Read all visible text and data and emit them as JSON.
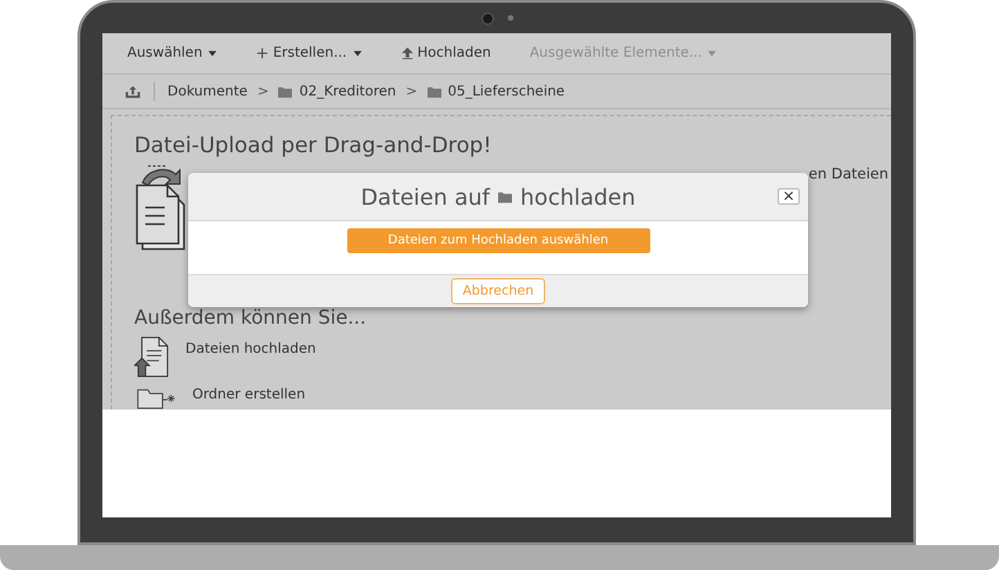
{
  "toolbar": {
    "items": [
      {
        "label": "Auswählen",
        "kind": "plain",
        "dropdown": true,
        "disabled": false
      },
      {
        "label": "Erstellen...",
        "kind": "plus",
        "dropdown": true,
        "disabled": false
      },
      {
        "label": "Hochladen",
        "kind": "upload",
        "dropdown": false,
        "disabled": false
      },
      {
        "label": "Ausgewählte Elemente...",
        "kind": "plain",
        "dropdown": true,
        "disabled": true
      }
    ]
  },
  "breadcrumb": {
    "separator": ">",
    "items": [
      {
        "label": "Dokumente",
        "folder": false
      },
      {
        "label": "02_Kreditoren",
        "folder": true
      },
      {
        "label": "05_Lieferscheine",
        "folder": true
      }
    ]
  },
  "content": {
    "heading": "Datei-Upload per Drag-and-Drop!",
    "side_text": "en Dateien",
    "section_heading": "Außerdem können Sie...",
    "actions": [
      {
        "label": "Dateien hochladen",
        "kind": "upload"
      },
      {
        "label": "Ordner erstellen",
        "kind": "folder"
      }
    ]
  },
  "dialog": {
    "title_before": "Dateien auf",
    "title_after": "hochladen",
    "close": "×",
    "primary": "Dateien zum Hochladen auswählen",
    "cancel": "Abbrechen"
  }
}
